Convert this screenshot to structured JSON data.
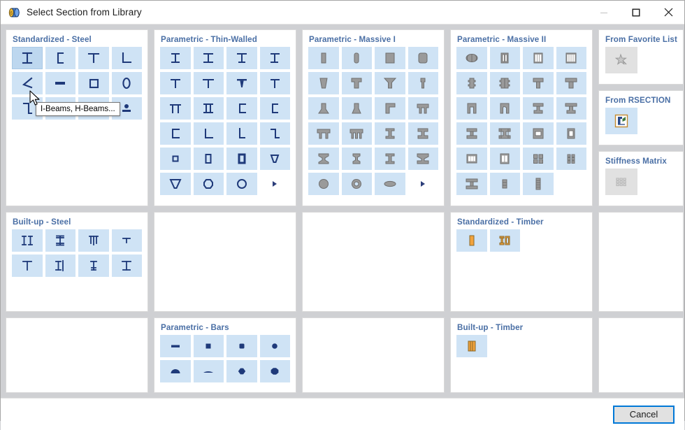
{
  "window": {
    "title": "Select Section from Library",
    "icon": "library-section-icon",
    "controls": [
      {
        "name": "minimize-button",
        "glyph": "minimize",
        "disabled": true
      },
      {
        "name": "maximize-button",
        "glyph": "maximize",
        "disabled": false
      },
      {
        "name": "close-button",
        "glyph": "close",
        "disabled": false
      }
    ]
  },
  "tooltip": {
    "text": "I-Beams, H-Beams...",
    "visible": true
  },
  "panels": [
    {
      "id": "standardized-steel",
      "title": "Standardized - Steel",
      "style": "outline-blue",
      "columns": 4,
      "items": [
        {
          "name": "i-beam-section",
          "shape": "i"
        },
        {
          "name": "channel-section",
          "shape": "c"
        },
        {
          "name": "tee-section",
          "shape": "t"
        },
        {
          "name": "angle-section",
          "shape": "l"
        },
        {
          "name": "angle-rotated-section",
          "shape": "angle"
        },
        {
          "name": "flat-bar-section",
          "shape": "flat"
        },
        {
          "name": "square-hollow-section",
          "shape": "sq"
        },
        {
          "name": "round-hollow-section",
          "shape": "o"
        },
        {
          "name": "z-section",
          "shape": "z"
        },
        {
          "name": "rail-section",
          "shape": "rail"
        },
        {
          "name": "corrugated-sheet-section",
          "shape": "wave"
        },
        {
          "name": "pin-section",
          "shape": "pin"
        }
      ]
    },
    {
      "id": "parametric-thin-walled",
      "title": "Parametric - Thin-Walled",
      "style": "outline-blue",
      "columns": 4,
      "items": [
        {
          "name": "thin-i-symmetric",
          "shape": "i"
        },
        {
          "name": "thin-i-tapered",
          "shape": "i2"
        },
        {
          "name": "thin-i-unequal",
          "shape": "i3"
        },
        {
          "name": "thin-i-asymmetric",
          "shape": "i4"
        },
        {
          "name": "thin-tee-1",
          "shape": "t"
        },
        {
          "name": "thin-tee-2",
          "shape": "t2"
        },
        {
          "name": "thin-tee-3",
          "shape": "t3"
        },
        {
          "name": "thin-tee-4",
          "shape": "t4"
        },
        {
          "name": "thin-pi-section",
          "shape": "pi"
        },
        {
          "name": "thin-double-i",
          "shape": "ii"
        },
        {
          "name": "thin-channel-1",
          "shape": "c"
        },
        {
          "name": "thin-channel-2",
          "shape": "c2"
        },
        {
          "name": "thin-channel-3",
          "shape": "c3"
        },
        {
          "name": "thin-angle-1",
          "shape": "l"
        },
        {
          "name": "thin-angle-2",
          "shape": "l2"
        },
        {
          "name": "thin-zed",
          "shape": "z"
        },
        {
          "name": "thin-square-hollow-small",
          "shape": "sq-s"
        },
        {
          "name": "thin-rect-hollow",
          "shape": "rect"
        },
        {
          "name": "thin-rect-hollow-thick",
          "shape": "rect2"
        },
        {
          "name": "thin-trapezoid-small",
          "shape": "trap-s"
        },
        {
          "name": "thin-trapezoid",
          "shape": "trap"
        },
        {
          "name": "thin-octagon-hollow",
          "shape": "oct"
        },
        {
          "name": "thin-circle-hollow",
          "shape": "o"
        },
        {
          "name": "thin-more-arrow",
          "shape": "arrow",
          "blank": true
        }
      ]
    },
    {
      "id": "parametric-massive-i",
      "title": "Parametric - Massive I",
      "style": "solid-gray",
      "columns": 4,
      "items": [
        {
          "name": "massive-rect-narrow",
          "shape": "m-rect-n"
        },
        {
          "name": "massive-rect-rounded",
          "shape": "m-rect-r"
        },
        {
          "name": "massive-square",
          "shape": "m-sq"
        },
        {
          "name": "massive-square-rounded",
          "shape": "m-sq-r"
        },
        {
          "name": "massive-taper",
          "shape": "m-taper"
        },
        {
          "name": "massive-tee-1",
          "shape": "m-t1"
        },
        {
          "name": "massive-tee-2",
          "shape": "m-t2"
        },
        {
          "name": "massive-tee-narrow",
          "shape": "m-t3"
        },
        {
          "name": "massive-inverted-tee-1",
          "shape": "m-it1"
        },
        {
          "name": "massive-inverted-tee-2",
          "shape": "m-it2"
        },
        {
          "name": "massive-angle-tee",
          "shape": "m-at"
        },
        {
          "name": "massive-double-leg",
          "shape": "m-dl"
        },
        {
          "name": "massive-double-leg-2",
          "shape": "m-dl2"
        },
        {
          "name": "massive-triple-leg",
          "shape": "m-tl"
        },
        {
          "name": "massive-i-1",
          "shape": "m-i1"
        },
        {
          "name": "massive-i-2",
          "shape": "m-i2"
        },
        {
          "name": "massive-i-3",
          "shape": "m-i3"
        },
        {
          "name": "massive-i-narrow",
          "shape": "m-i4"
        },
        {
          "name": "massive-i-5",
          "shape": "m-i5"
        },
        {
          "name": "massive-i-6",
          "shape": "m-i6"
        },
        {
          "name": "massive-circle",
          "shape": "m-circ"
        },
        {
          "name": "massive-ring",
          "shape": "m-ring"
        },
        {
          "name": "massive-ellipse",
          "shape": "m-ell"
        },
        {
          "name": "massive-more-arrow",
          "shape": "arrow",
          "blank": true
        }
      ]
    },
    {
      "id": "parametric-massive-ii",
      "title": "Parametric - Massive II",
      "style": "solid-gray",
      "columns": 4,
      "items": [
        {
          "name": "hollow-core-round",
          "shape": "hc-round"
        },
        {
          "name": "hollow-core-2-cell",
          "shape": "hc2"
        },
        {
          "name": "hollow-core-3-cell",
          "shape": "hc3"
        },
        {
          "name": "hollow-core-4-cell",
          "shape": "hc4"
        },
        {
          "name": "notched-narrow",
          "shape": "nn1"
        },
        {
          "name": "notched-double",
          "shape": "nn2"
        },
        {
          "name": "tee-solid-1",
          "shape": "ts1"
        },
        {
          "name": "tee-solid-2",
          "shape": "ts2"
        },
        {
          "name": "portal-1",
          "shape": "p1"
        },
        {
          "name": "portal-2",
          "shape": "p2"
        },
        {
          "name": "i-ledge-1",
          "shape": "il1"
        },
        {
          "name": "i-ledge-2",
          "shape": "il2"
        },
        {
          "name": "i-ledge-3",
          "shape": "il3"
        },
        {
          "name": "i-ledge-4",
          "shape": "il4"
        },
        {
          "name": "box-with-cell-1",
          "shape": "bc1"
        },
        {
          "name": "box-with-cell-2",
          "shape": "bc2"
        },
        {
          "name": "box-3-cell",
          "shape": "b3"
        },
        {
          "name": "box-2-cell-tall",
          "shape": "b2t"
        },
        {
          "name": "grid-4-cell",
          "shape": "g4"
        },
        {
          "name": "grid-6-cell",
          "shape": "g6"
        },
        {
          "name": "i-bolted",
          "shape": "ib"
        },
        {
          "name": "stacked-small",
          "shape": "st1"
        },
        {
          "name": "stacked-tall",
          "shape": "st2"
        }
      ]
    },
    {
      "id": "built-up-steel",
      "title": "Built-up - Steel",
      "style": "outline-blue",
      "columns": 4,
      "items": [
        {
          "name": "built-up-double-i",
          "shape": "b-ii"
        },
        {
          "name": "built-up-i-plated",
          "shape": "b-i2"
        },
        {
          "name": "built-up-tee-plate",
          "shape": "b-tp"
        },
        {
          "name": "built-up-tee-small",
          "shape": "b-ts"
        },
        {
          "name": "built-up-tee-1",
          "shape": "b-t1"
        },
        {
          "name": "built-up-i-channel",
          "shape": "b-ic"
        },
        {
          "name": "built-up-i-narrow",
          "shape": "b-in"
        },
        {
          "name": "built-up-i-wide",
          "shape": "b-iw"
        }
      ]
    },
    {
      "id": "parametric-bars",
      "title": "Parametric - Bars",
      "style": "outline-blue",
      "columns": 4,
      "items": [
        {
          "name": "bar-flat",
          "shape": "bar-flat"
        },
        {
          "name": "bar-square",
          "shape": "bar-sq"
        },
        {
          "name": "bar-square-rounded",
          "shape": "bar-sqr"
        },
        {
          "name": "bar-round",
          "shape": "bar-round"
        },
        {
          "name": "bar-half-round",
          "shape": "bar-half"
        },
        {
          "name": "bar-segment",
          "shape": "bar-seg"
        },
        {
          "name": "bar-hexagon",
          "shape": "bar-hex"
        },
        {
          "name": "bar-octagon",
          "shape": "bar-oct"
        }
      ]
    },
    {
      "id": "standardized-timber",
      "title": "Standardized - Timber",
      "style": "timber",
      "columns": 4,
      "items": [
        {
          "name": "timber-rect",
          "shape": "tb-rect"
        },
        {
          "name": "timber-i-joist",
          "shape": "tb-i"
        }
      ]
    },
    {
      "id": "built-up-timber",
      "title": "Built-up - Timber",
      "style": "timber",
      "columns": 4,
      "items": [
        {
          "name": "timber-glulam",
          "shape": "tb-glulam"
        }
      ]
    },
    {
      "id": "empty-panel-1",
      "title": "",
      "items": []
    },
    {
      "id": "empty-panel-2",
      "title": "",
      "items": []
    },
    {
      "id": "empty-panel-3",
      "title": "",
      "items": []
    },
    {
      "id": "empty-panel-4",
      "title": "",
      "items": []
    },
    {
      "id": "empty-panel-5",
      "title": "",
      "items": []
    }
  ],
  "side_panels": [
    {
      "id": "from-favorite-list",
      "title": "From Favorite List",
      "icon": "star-pin-icon",
      "selected": false
    },
    {
      "id": "from-rsection",
      "title": "From RSECTION",
      "icon": "rsection-icon",
      "selected": true
    },
    {
      "id": "stiffness-matrix",
      "title": "Stiffness Matrix",
      "icon": "matrix-grid-icon",
      "selected": false
    }
  ],
  "footer": {
    "cancel_label": "Cancel"
  },
  "colors": {
    "cell_blue": "#cfe3f5",
    "cell_blue_hover": "#bdd7ef",
    "panel_title": "#4a6fa5",
    "icon_navy": "#1f3a7a",
    "icon_gray": "#8e8e8e",
    "icon_timber": "#f0a030",
    "window_bg": "#cfd0d3",
    "accent_focus": "#0078d7"
  }
}
